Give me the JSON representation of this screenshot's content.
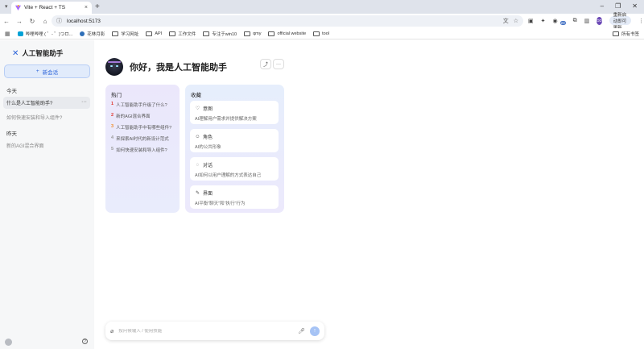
{
  "browser": {
    "tab_title": "Vite + React + TS",
    "tab_close": "×",
    "new_tab": "+",
    "url": "localhost:5173",
    "update_label": "重新启动即可更新",
    "avatar_text": "DD",
    "ext_badge": "23"
  },
  "bookmarks": [
    {
      "label": "哔哩哔哩 ( ゜- ゜)つロ...",
      "icon": "bilibili-icon"
    },
    {
      "label": "花林月影",
      "icon": "globe-icon"
    },
    {
      "label": "学习网址",
      "icon": "folder-icon"
    },
    {
      "label": "API",
      "icon": "folder-icon"
    },
    {
      "label": "工作文件",
      "icon": "folder-icon"
    },
    {
      "label": "专注于win10",
      "icon": "folder-icon"
    },
    {
      "label": "qmy",
      "icon": "folder-icon"
    },
    {
      "label": "official website",
      "icon": "folder-icon"
    },
    {
      "label": "tool",
      "icon": "folder-icon"
    }
  ],
  "bookmarks_all": "所有书签",
  "sidebar": {
    "title": "人工智能助手",
    "new_conversation": "新会话",
    "groups": [
      {
        "label": "今天",
        "items": [
          "什么是人工智能助手?",
          "如何快速安装和导入组件?"
        ]
      },
      {
        "label": "昨天",
        "items": [
          "新的AGI混合界面"
        ]
      }
    ],
    "more": "···"
  },
  "welcome": {
    "title": "你好，我是人工智能助手",
    "share_icon": "share-icon",
    "more": "···"
  },
  "hot": {
    "title": "热门",
    "items": [
      {
        "num": "1",
        "text": "人工智能助手升级了什么?",
        "color": "#e0362c"
      },
      {
        "num": "2",
        "text": "新的AGI混合界面",
        "color": "#e0362c"
      },
      {
        "num": "3",
        "text": "人工智能助手中有哪些组件?",
        "color": "#f08a24"
      },
      {
        "num": "4",
        "text": "来探索AI时代的新设计范式",
        "color": "#999999"
      },
      {
        "num": "5",
        "text": "如何快速安装和导入组件?",
        "color": "#999999"
      }
    ]
  },
  "favorites": {
    "title": "收藏",
    "items": [
      {
        "title": "意图",
        "desc": "AI理解用户需求并提供解决方案",
        "icon": "heart-icon"
      },
      {
        "title": "角色",
        "desc": "AI的公共形象",
        "icon": "smile-icon"
      },
      {
        "title": "对话",
        "desc": "AI如何以用户理解的方式表达自己",
        "icon": "chat-icon"
      },
      {
        "title": "界面",
        "desc": "AI平衡\"聊天\"和\"执行\"行为",
        "icon": "paint-icon"
      }
    ]
  },
  "sender": {
    "placeholder": "按问候输入 / 使用技能"
  },
  "colors": {
    "accent": "#2b63d9",
    "send_button": "#a6c3f5"
  }
}
